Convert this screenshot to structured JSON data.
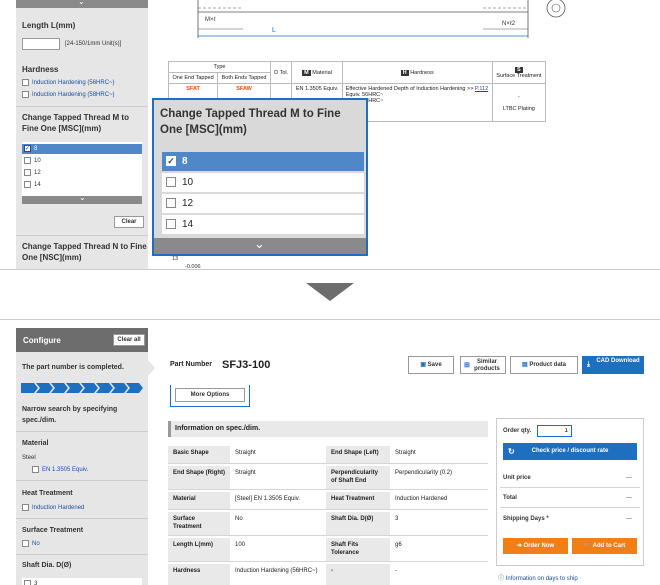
{
  "top": {
    "length": {
      "label": "Length L(mm)",
      "hint": "[24-150/1mm Unit(s)]"
    },
    "hardness": {
      "label": "Hardness",
      "options": [
        "Induction Hardening (56HRC~)",
        "Induction Hardening (58HRC~)"
      ]
    },
    "msc": {
      "label": "Change Tapped Thread M to Fine One [MSC](mm)",
      "options": [
        "8",
        "10",
        "12",
        "14"
      ],
      "selected": "8",
      "clear_label": "Clear"
    },
    "nsc": {
      "label": "Change Tapped Thread N to Fine One [NSC](mm)"
    },
    "diagram": {
      "m_label": "M×ℓ",
      "n_label": "N×ℓ2",
      "l_label": "L"
    },
    "table": {
      "type_header": "Type",
      "col_one_end": "One End Tapped",
      "col_both_end": "Both Ends Tapped",
      "col_dtol": "D Tol.",
      "col_material_icon": "M",
      "col_material": "Material",
      "col_hardness_icon": "H",
      "col_hardness": "Hardness",
      "col_surface_icon": "S",
      "col_surface": "Surface Treatment",
      "row_one_end": "SFAT",
      "row_both_end": "SFAW",
      "row_material": "EN 1.3505 Equiv.",
      "row_hardness_text": "Effective Hardened Depth of Induction Hardening >> ",
      "row_hardness_link": "P.112",
      "row_hardness_line2": "Equiv. 56HRC~",
      "row_hardness_line3": "Equiv. 56HRC~",
      "row_surface_dash": "-",
      "row_surface": "LTBC Plating",
      "bottom_val1": "13",
      "bottom_val2": "-0.006"
    },
    "popup": {
      "title": "Change Tapped Thread M to Fine One [MSC](mm)",
      "options": [
        "8",
        "10",
        "12",
        "14"
      ]
    }
  },
  "bottom": {
    "configure": "Configure",
    "clear_all": "Clear all",
    "completed": "The part number is completed.",
    "narrow": "Narrow search by specifying spec./dim.",
    "material_label": "Material",
    "material_group": "Steel",
    "material_option": "EN 1.3505 Equiv.",
    "heat_label": "Heat Treatment",
    "heat_option": "Induction Hardened",
    "surface_label": "Surface Treatment",
    "surface_option": "No",
    "shaft_label": "Shaft Dia. D(Ø)",
    "shaft_option": "3",
    "part_number_label": "Part Number",
    "part_number": "SFJ3-100",
    "more_options": "More Options",
    "toolbar": {
      "save": "Save",
      "similar": "Similar products",
      "product_data": "Product data",
      "cad": "CAD Download"
    },
    "info_header": "Information on spec./dim.",
    "specs": [
      [
        "Basic Shape",
        "Straight",
        "End Shape (Left)",
        "Straight"
      ],
      [
        "End Shape (Right)",
        "Straight",
        "Perpendicularity of Shaft End",
        "Perpendicularity (0.2)"
      ],
      [
        "Material",
        "[Steel] EN 1.3505 Equiv.",
        "Heat Treatment",
        "Induction Hardened"
      ],
      [
        "Surface Treatment",
        "No",
        "Shaft Dia. D(Ø)",
        "3"
      ],
      [
        "Length L(mm)",
        "100",
        "Shaft Fits Tolerance",
        "g6"
      ],
      [
        "Hardness",
        "Induction Hardening (56HRC~)",
        "-",
        "-"
      ]
    ],
    "order": {
      "qty_label": "Order qty.",
      "qty_value": "1",
      "check_price": "Check price / discount rate",
      "unit_price": "Unit price",
      "unit_price_val": "---",
      "total": "Total",
      "total_val": "---",
      "shipping": "Shipping Days *",
      "shipping_val": "---",
      "order_now": "Order Now",
      "add_cart": "Add to Cart",
      "info_days": "Information on days to ship"
    }
  }
}
